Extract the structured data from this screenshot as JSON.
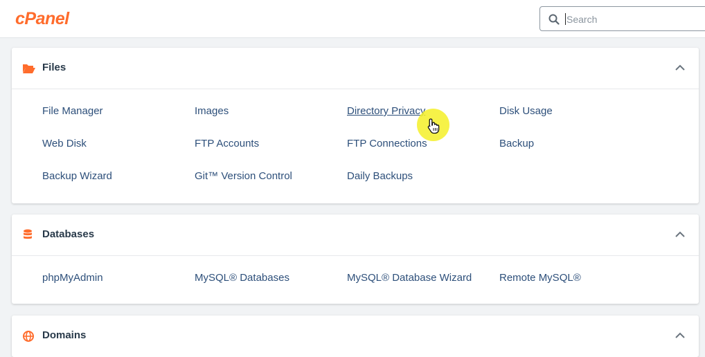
{
  "header": {
    "logo_text": "cPanel",
    "search_placeholder": "Search"
  },
  "sections": [
    {
      "title": "Files",
      "icon": "folder-open-icon",
      "items": [
        [
          "File Manager",
          "Images",
          "Directory Privacy",
          "Disk Usage"
        ],
        [
          "Web Disk",
          "FTP Accounts",
          "FTP Connections",
          "Backup"
        ],
        [
          "Backup Wizard",
          "Git™ Version Control",
          "Daily Backups"
        ]
      ]
    },
    {
      "title": "Databases",
      "icon": "database-icon",
      "items": [
        [
          "phpMyAdmin",
          "MySQL® Databases",
          "MySQL® Database Wizard",
          "Remote MySQL®"
        ]
      ]
    },
    {
      "title": "Domains",
      "icon": "globe-icon",
      "items": []
    }
  ],
  "colors": {
    "brand": "#ff6c2c",
    "link": "#2d4f7a",
    "cursor_highlight": "#f5f028"
  },
  "hovered_item": "Directory Privacy"
}
